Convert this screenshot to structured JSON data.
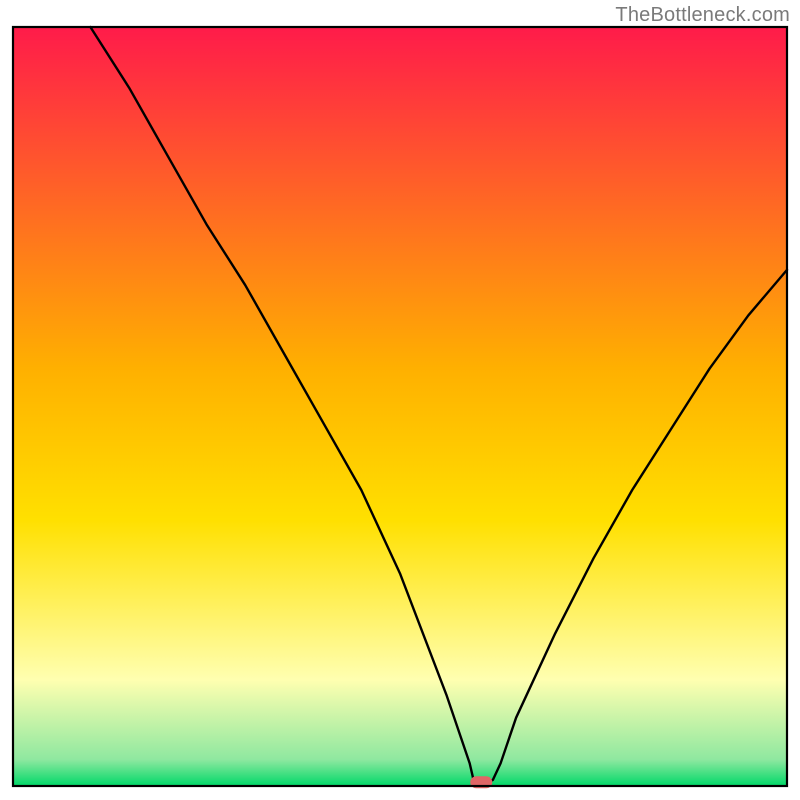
{
  "attribution": "TheBottleneck.com",
  "colors": {
    "gradient_top": "#ff1b4a",
    "gradient_mid": "#ffd400",
    "gradient_low": "#ffffb0",
    "gradient_bottom": "#00e676",
    "frame": "#000000",
    "curve": "#000000",
    "marker_fill": "#e06666",
    "marker_stroke": "#c05050"
  },
  "chart_data": {
    "type": "line",
    "title": "",
    "xlabel": "",
    "ylabel": "",
    "xlim": [
      0,
      100
    ],
    "ylim": [
      0,
      100
    ],
    "series": [
      {
        "name": "bottleneck-curve",
        "x": [
          10,
          15,
          20,
          25,
          30,
          35,
          40,
          45,
          50,
          53,
          56,
          59,
          59.5,
          60,
          60.5,
          61,
          62,
          63,
          64,
          65,
          70,
          75,
          80,
          85,
          90,
          95,
          100
        ],
        "y": [
          100,
          92,
          83,
          74,
          66,
          57,
          48,
          39,
          28,
          20,
          12,
          3,
          0.8,
          0.3,
          0.3,
          0.3,
          0.8,
          3,
          6,
          9,
          20,
          30,
          39,
          47,
          55,
          62,
          68
        ]
      }
    ],
    "marker": {
      "x": 60.5,
      "y": 0.5,
      "label": "optimal-point"
    },
    "background": {
      "type": "vertical-gradient",
      "stops": [
        {
          "pos": 0.0,
          "color": "#ff1b4a"
        },
        {
          "pos": 0.45,
          "color": "#ffb000"
        },
        {
          "pos": 0.65,
          "color": "#ffe000"
        },
        {
          "pos": 0.86,
          "color": "#ffffb0"
        },
        {
          "pos": 0.965,
          "color": "#8fe8a0"
        },
        {
          "pos": 1.0,
          "color": "#00d868"
        }
      ]
    }
  }
}
